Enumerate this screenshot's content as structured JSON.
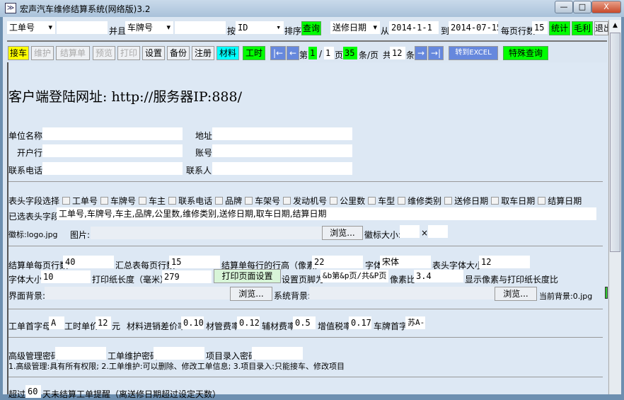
{
  "window": {
    "title": "宏声汽车维修结算系统(网络版)3.2",
    "minimize": "—",
    "maximize": "□",
    "close": "X"
  },
  "toolbar1": {
    "field1": "工单号",
    "value1": "",
    "and_label": "并且",
    "field2": "车牌号",
    "value2": "",
    "by_label": "按",
    "sort_field": "ID",
    "sort_label": "排序",
    "query": "查询",
    "date_field": "送修日期",
    "from_label": "从",
    "from_date": "2014-1-1",
    "to_label": "到",
    "to_date": "2014-07-15",
    "rows_label": "每页行数",
    "rows_value": "15",
    "stats": "统计",
    "profit": "毛利",
    "exit": "退出"
  },
  "toolbar2": {
    "buttons": [
      "接车",
      "维护",
      "结算单",
      "预览",
      "打印",
      "设置",
      "备份",
      "注册",
      "材料",
      "工时"
    ],
    "first": "|←",
    "prev": "←",
    "page_prefix": "第",
    "page": "1",
    "slash": "/",
    "total_pages": "1",
    "page_suffix": "页",
    "per_page": "35",
    "per_page_suffix": "条/页",
    "total_prefix": "共",
    "total": "12",
    "total_suffix": "条",
    "next": "→",
    "last": "→|",
    "excel": "转到EXCEL",
    "special": "特殊查询"
  },
  "content": {
    "url_heading": "客户端登陆网址: http://服务器IP:888/",
    "company": {
      "name_label": "单位名称",
      "name": "",
      "address_label": "地址",
      "address": "",
      "bank_label": "开户行",
      "bank": "",
      "account_label": "账号",
      "account": "",
      "phone_label": "联系电话",
      "phone": "",
      "contact_label": "联系人",
      "contact": ""
    },
    "header_fields": {
      "label": "表头字段选择",
      "options": [
        "工单号",
        "车牌号",
        "车主",
        "联系电话",
        "品牌",
        "车架号",
        "发动机号",
        "公里数",
        "车型",
        "维修类别",
        "送修日期",
        "取车日期",
        "结算日期"
      ],
      "selected_label": "已选表头字段",
      "selected": "工单号,车牌号,车主,品牌,公里数,维修类别,送修日期,取车日期,结算日期"
    },
    "logo": {
      "label": "徽标:logo.jpg",
      "image_label": "图片:",
      "image": "",
      "browse": "浏览...",
      "size_label": "徽标大小:",
      "width": "",
      "x": "×",
      "height": ""
    },
    "print": {
      "settle_rows_label": "结算单每页行数",
      "settle_rows": "40",
      "summary_rows_label": "汇总表每页行数",
      "summary_rows": "15",
      "row_height_label": "结算单每行的行高（像素）",
      "row_height": "22",
      "font_label": "字体",
      "font": "宋体",
      "header_font_size_label": "表头字体大小",
      "header_font_size": "12",
      "font_size_label": "字体大小",
      "font_size": "10",
      "paper_len_label": "打印纸长度（毫米）",
      "paper_len": "279",
      "page_setup": "打印页面设置",
      "footer_label": "设置页脚为",
      "footer": "&b第&p页/共&P页",
      "ratio_label": "像素比",
      "ratio": "3.4",
      "ratio_note": "显示像素与打印纸长度比",
      "ui_bg_label": "界面背景:",
      "ui_bg": "",
      "browse1": "浏览...",
      "sys_bg_label": "系统背景:",
      "sys_bg": "",
      "browse2": "浏览...",
      "current_bg": "当前背景:0.jpg"
    },
    "rates": {
      "prefix_label": "工单首字母",
      "prefix": "A",
      "labor_label": "工时单价",
      "labor": "12",
      "yuan": "元",
      "diff_label": "材料进销差价率",
      "diff": "0.10",
      "mgmt_label": "材管费率",
      "mgmt": "0.12",
      "aux_label": "辅材费率",
      "aux": "0.5",
      "vat_label": "增值税率",
      "vat": "0.17",
      "plate_label": "车牌首字",
      "plate": "苏A-"
    },
    "passwords": {
      "admin_label": "高级管理密码",
      "maint_label": "工单维护密码",
      "entry_label": "项目录入密码",
      "note": "1.高级管理:具有所有权限; 2.工单维护:可以删除、修改工单信息; 3.项目录入:只能接车、修改项目"
    },
    "reminder": {
      "prefix": "超过",
      "days": "60",
      "suffix": "天未结算工单提醒（离送修日期超过设定天数）"
    }
  }
}
